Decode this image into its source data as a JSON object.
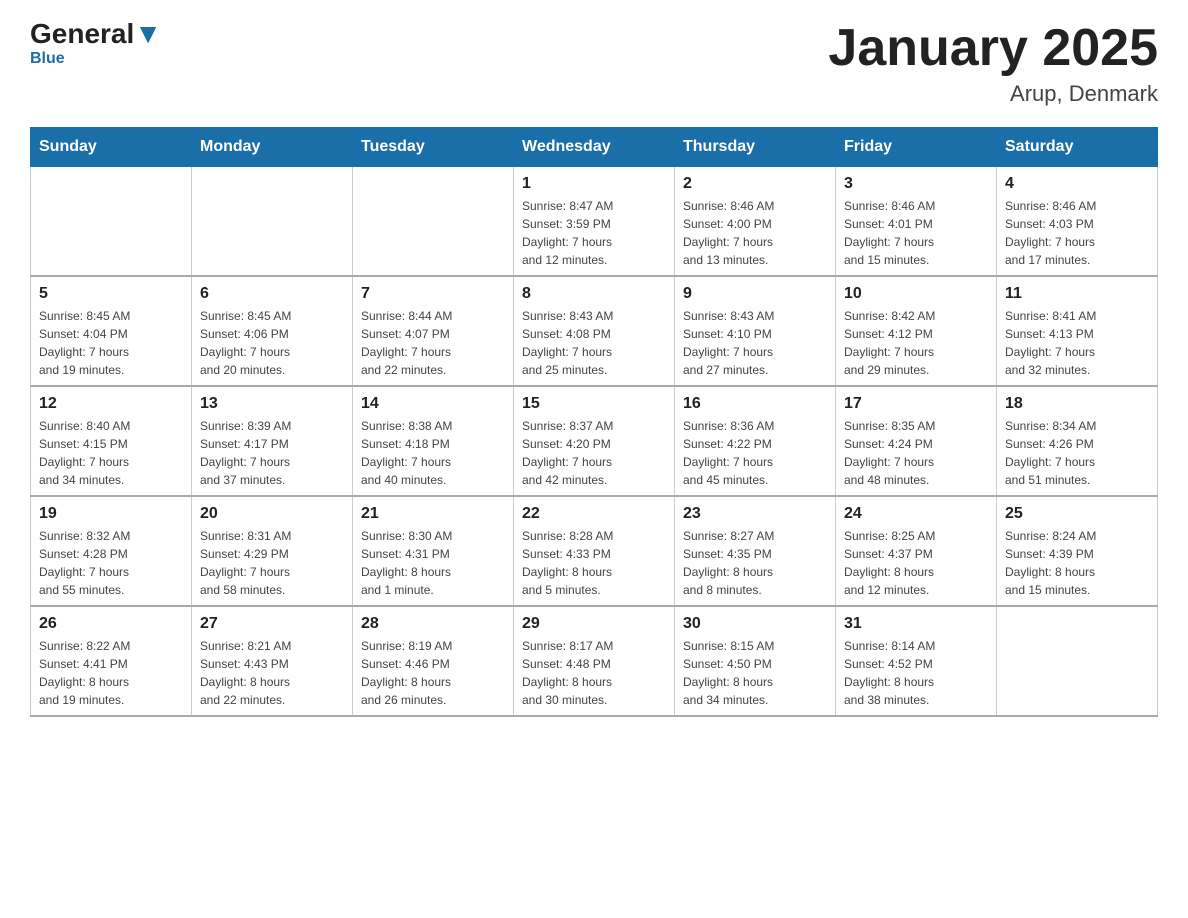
{
  "header": {
    "logo_general": "General",
    "logo_blue": "Blue",
    "title": "January 2025",
    "subtitle": "Arup, Denmark"
  },
  "weekdays": [
    "Sunday",
    "Monday",
    "Tuesday",
    "Wednesday",
    "Thursday",
    "Friday",
    "Saturday"
  ],
  "weeks": [
    [
      {
        "day": "",
        "info": ""
      },
      {
        "day": "",
        "info": ""
      },
      {
        "day": "",
        "info": ""
      },
      {
        "day": "1",
        "info": "Sunrise: 8:47 AM\nSunset: 3:59 PM\nDaylight: 7 hours\nand 12 minutes."
      },
      {
        "day": "2",
        "info": "Sunrise: 8:46 AM\nSunset: 4:00 PM\nDaylight: 7 hours\nand 13 minutes."
      },
      {
        "day": "3",
        "info": "Sunrise: 8:46 AM\nSunset: 4:01 PM\nDaylight: 7 hours\nand 15 minutes."
      },
      {
        "day": "4",
        "info": "Sunrise: 8:46 AM\nSunset: 4:03 PM\nDaylight: 7 hours\nand 17 minutes."
      }
    ],
    [
      {
        "day": "5",
        "info": "Sunrise: 8:45 AM\nSunset: 4:04 PM\nDaylight: 7 hours\nand 19 minutes."
      },
      {
        "day": "6",
        "info": "Sunrise: 8:45 AM\nSunset: 4:06 PM\nDaylight: 7 hours\nand 20 minutes."
      },
      {
        "day": "7",
        "info": "Sunrise: 8:44 AM\nSunset: 4:07 PM\nDaylight: 7 hours\nand 22 minutes."
      },
      {
        "day": "8",
        "info": "Sunrise: 8:43 AM\nSunset: 4:08 PM\nDaylight: 7 hours\nand 25 minutes."
      },
      {
        "day": "9",
        "info": "Sunrise: 8:43 AM\nSunset: 4:10 PM\nDaylight: 7 hours\nand 27 minutes."
      },
      {
        "day": "10",
        "info": "Sunrise: 8:42 AM\nSunset: 4:12 PM\nDaylight: 7 hours\nand 29 minutes."
      },
      {
        "day": "11",
        "info": "Sunrise: 8:41 AM\nSunset: 4:13 PM\nDaylight: 7 hours\nand 32 minutes."
      }
    ],
    [
      {
        "day": "12",
        "info": "Sunrise: 8:40 AM\nSunset: 4:15 PM\nDaylight: 7 hours\nand 34 minutes."
      },
      {
        "day": "13",
        "info": "Sunrise: 8:39 AM\nSunset: 4:17 PM\nDaylight: 7 hours\nand 37 minutes."
      },
      {
        "day": "14",
        "info": "Sunrise: 8:38 AM\nSunset: 4:18 PM\nDaylight: 7 hours\nand 40 minutes."
      },
      {
        "day": "15",
        "info": "Sunrise: 8:37 AM\nSunset: 4:20 PM\nDaylight: 7 hours\nand 42 minutes."
      },
      {
        "day": "16",
        "info": "Sunrise: 8:36 AM\nSunset: 4:22 PM\nDaylight: 7 hours\nand 45 minutes."
      },
      {
        "day": "17",
        "info": "Sunrise: 8:35 AM\nSunset: 4:24 PM\nDaylight: 7 hours\nand 48 minutes."
      },
      {
        "day": "18",
        "info": "Sunrise: 8:34 AM\nSunset: 4:26 PM\nDaylight: 7 hours\nand 51 minutes."
      }
    ],
    [
      {
        "day": "19",
        "info": "Sunrise: 8:32 AM\nSunset: 4:28 PM\nDaylight: 7 hours\nand 55 minutes."
      },
      {
        "day": "20",
        "info": "Sunrise: 8:31 AM\nSunset: 4:29 PM\nDaylight: 7 hours\nand 58 minutes."
      },
      {
        "day": "21",
        "info": "Sunrise: 8:30 AM\nSunset: 4:31 PM\nDaylight: 8 hours\nand 1 minute."
      },
      {
        "day": "22",
        "info": "Sunrise: 8:28 AM\nSunset: 4:33 PM\nDaylight: 8 hours\nand 5 minutes."
      },
      {
        "day": "23",
        "info": "Sunrise: 8:27 AM\nSunset: 4:35 PM\nDaylight: 8 hours\nand 8 minutes."
      },
      {
        "day": "24",
        "info": "Sunrise: 8:25 AM\nSunset: 4:37 PM\nDaylight: 8 hours\nand 12 minutes."
      },
      {
        "day": "25",
        "info": "Sunrise: 8:24 AM\nSunset: 4:39 PM\nDaylight: 8 hours\nand 15 minutes."
      }
    ],
    [
      {
        "day": "26",
        "info": "Sunrise: 8:22 AM\nSunset: 4:41 PM\nDaylight: 8 hours\nand 19 minutes."
      },
      {
        "day": "27",
        "info": "Sunrise: 8:21 AM\nSunset: 4:43 PM\nDaylight: 8 hours\nand 22 minutes."
      },
      {
        "day": "28",
        "info": "Sunrise: 8:19 AM\nSunset: 4:46 PM\nDaylight: 8 hours\nand 26 minutes."
      },
      {
        "day": "29",
        "info": "Sunrise: 8:17 AM\nSunset: 4:48 PM\nDaylight: 8 hours\nand 30 minutes."
      },
      {
        "day": "30",
        "info": "Sunrise: 8:15 AM\nSunset: 4:50 PM\nDaylight: 8 hours\nand 34 minutes."
      },
      {
        "day": "31",
        "info": "Sunrise: 8:14 AM\nSunset: 4:52 PM\nDaylight: 8 hours\nand 38 minutes."
      },
      {
        "day": "",
        "info": ""
      }
    ]
  ]
}
